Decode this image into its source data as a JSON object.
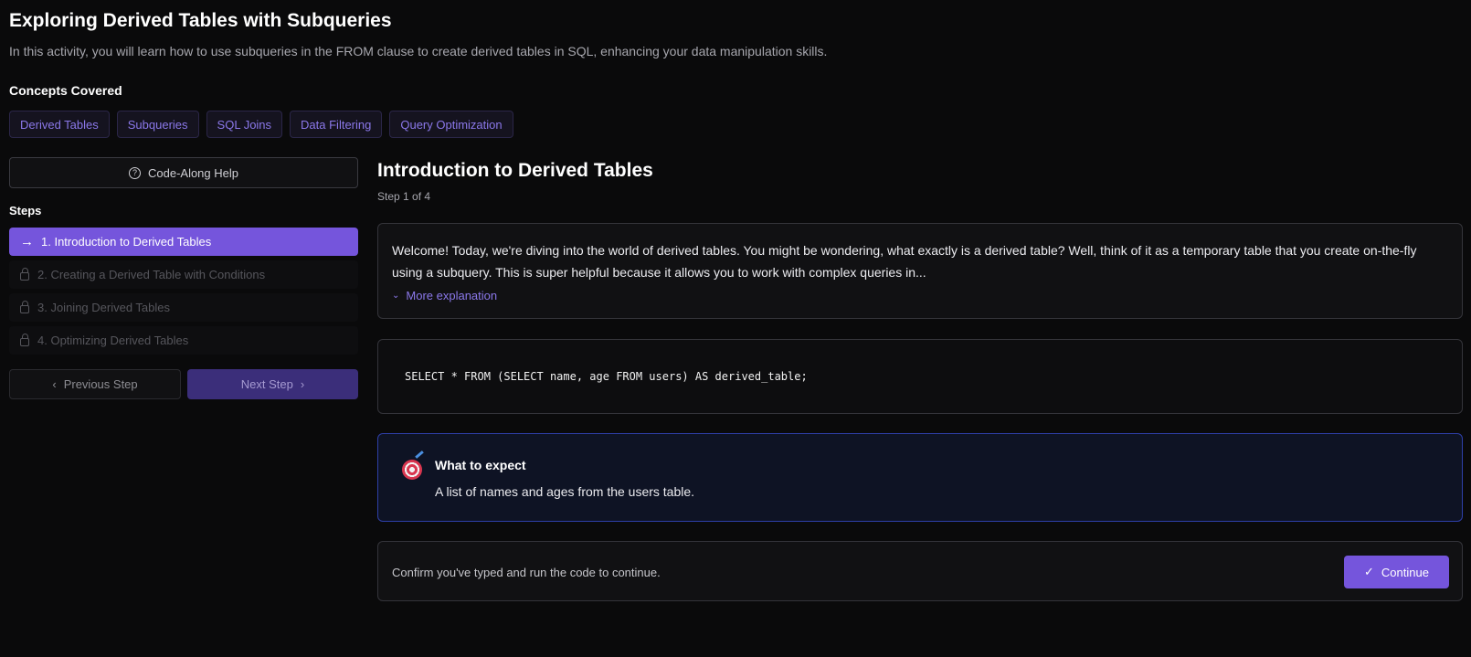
{
  "header": {
    "title": "Exploring Derived Tables with Subqueries",
    "description": "In this activity, you will learn how to use subqueries in the FROM clause to create derived tables in SQL, enhancing your data manipulation skills."
  },
  "concepts": {
    "label": "Concepts Covered",
    "items": [
      "Derived Tables",
      "Subqueries",
      "SQL Joins",
      "Data Filtering",
      "Query Optimization"
    ]
  },
  "sidebar": {
    "help_label": "Code-Along Help",
    "steps_label": "Steps",
    "steps": [
      {
        "label": "1. Introduction to Derived Tables"
      },
      {
        "label": "2. Creating a Derived Table with Conditions"
      },
      {
        "label": "3. Joining Derived Tables"
      },
      {
        "label": "4. Optimizing Derived Tables"
      }
    ],
    "prev_label": "Previous Step",
    "next_label": "Next Step"
  },
  "main": {
    "step_title": "Introduction to Derived Tables",
    "step_count": "Step 1 of 4",
    "explanation": "Welcome! Today, we're diving into the world of derived tables. You might be wondering, what exactly is a derived table? Well, think of it as a temporary table that you create on-the-fly using a subquery. This is super helpful because it allows you to work with complex queries in...",
    "more_label": "More explanation",
    "code": "SELECT * FROM (SELECT name, age FROM users) AS derived_table;",
    "expect_title": "What to expect",
    "expect_text": "A list of names and ages from the users table.",
    "confirm_text": "Confirm you've typed and run the code to continue.",
    "continue_label": "Continue"
  },
  "colors": {
    "accent": "#7555dc",
    "chip_text": "#8b78ea",
    "expect_border": "#2e3fa8"
  }
}
